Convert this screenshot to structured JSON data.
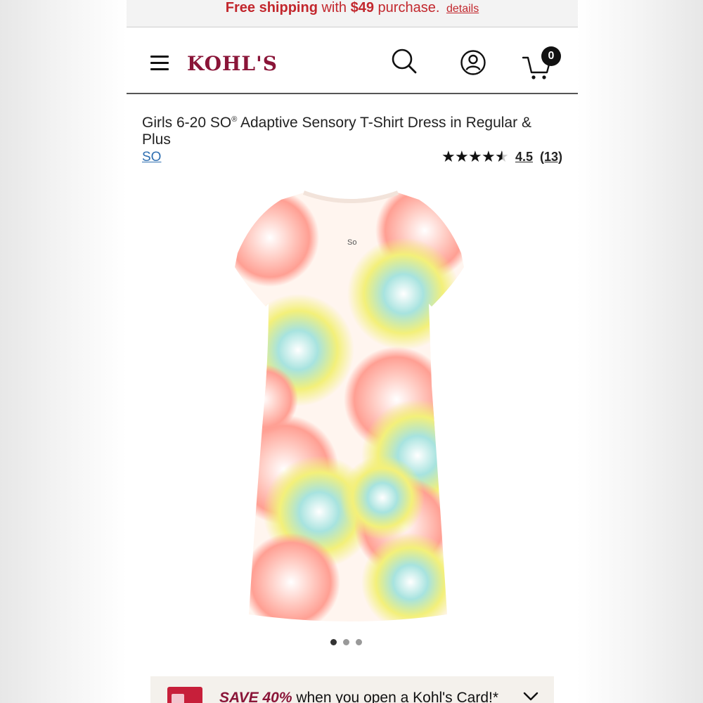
{
  "promo": {
    "prefix": "Free shipping",
    "middle": "with",
    "amount": "$49",
    "suffix": "purchase.",
    "link": "details",
    "color": "#c2272d"
  },
  "header": {
    "logo": "KOHL'S",
    "logo_color": "#8a1538",
    "cart_count": "0",
    "icons": [
      "menu-icon",
      "search-icon",
      "account-icon",
      "cart-icon"
    ]
  },
  "product": {
    "title_part1": "Girls 6-20 SO",
    "title_reg": "®",
    "title_part2": " Adaptive Sensory T-Shirt Dress in Regular & Plus",
    "brand": "SO",
    "rating_value": "4.5",
    "rating_count": "(13)",
    "stars": 4.5,
    "image_label": "So",
    "image_count": 3,
    "active_image": 1
  },
  "card_promo": {
    "save": "SAVE 40%",
    "text": " when you open a Kohl's Card!*"
  }
}
